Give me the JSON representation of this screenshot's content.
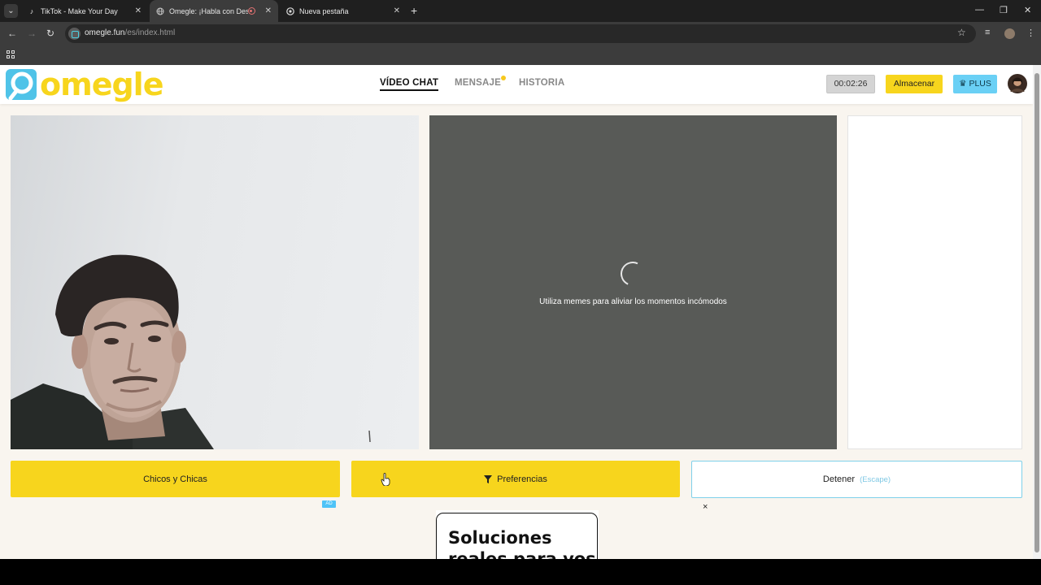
{
  "browser": {
    "tabs": [
      {
        "title": "TikTok - Make Your Day",
        "icon": "tiktok-icon"
      },
      {
        "title": "Omegle: ¡Habla con Descon",
        "icon": "globe-icon",
        "active": true,
        "recording": true
      },
      {
        "title": "Nueva pestaña",
        "icon": "chrome-icon"
      }
    ],
    "url_host": "omegle.fun",
    "url_path": "/es/index.html"
  },
  "header": {
    "logo_text": "omegle",
    "nav": [
      {
        "label": "VÍDEO CHAT",
        "active": true
      },
      {
        "label": "MENSAJE",
        "notification": true
      },
      {
        "label": "HISTORIA"
      }
    ],
    "timer": "00:02:26",
    "store_label": "Almacenar",
    "plus_label": "PLUS"
  },
  "remote_video": {
    "message": "Utiliza memes para aliviar los momentos incómodos"
  },
  "actions": {
    "gender_label": "Chicos y Chicas",
    "preferences_label": "Preferencias",
    "stop_label": "Detener",
    "stop_hint": "(Escape)"
  },
  "ad": {
    "badge": "AD",
    "close": "×",
    "line1": "Soluciones",
    "line2": "reales para vos"
  },
  "colors": {
    "brand_yellow": "#f7d51d",
    "plus_blue": "#6ad0f5",
    "remote_bg": "#585a57"
  }
}
